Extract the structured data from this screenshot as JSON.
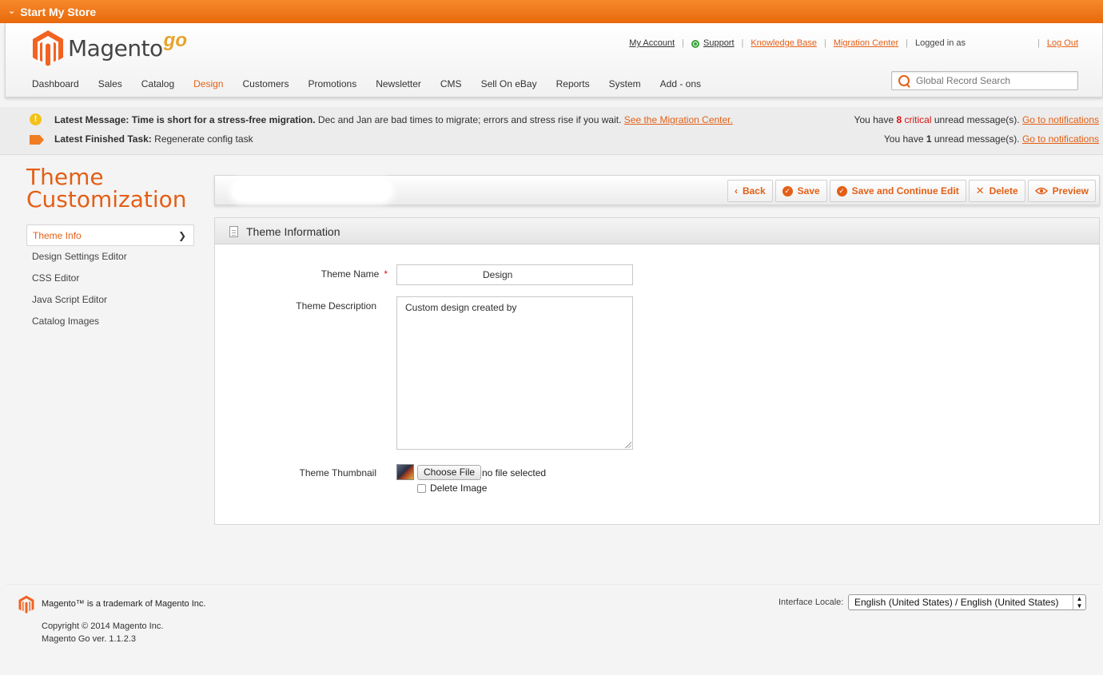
{
  "topbar": {
    "label": "Start My Store"
  },
  "header": {
    "brand": "Magento",
    "brand_suffix": "go",
    "links": {
      "my_account": "My Account",
      "support": "Support",
      "knowledge_base": "Knowledge Base",
      "migration_center": "Migration Center",
      "logged_in": "Logged in as",
      "log_out": "Log Out"
    },
    "nav": [
      "Dashboard",
      "Sales",
      "Catalog",
      "Design",
      "Customers",
      "Promotions",
      "Newsletter",
      "CMS",
      "Sell On eBay",
      "Reports",
      "System",
      "Add - ons"
    ],
    "nav_active": "Design",
    "search": {
      "placeholder": "Global Record Search"
    }
  },
  "messages": {
    "latest_label": "Latest Message:",
    "latest_bold": "Time is short for a stress-free migration.",
    "latest_text": "Dec and Jan are bad times to migrate; errors and stress rise if you wait.",
    "latest_link": "See the Migration Center.",
    "critical_prefix": "You have",
    "critical_count": "8 critical",
    "critical_suffix": "unread message(s).",
    "notif_link": "Go to notifications",
    "task_label": "Latest Finished Task:",
    "task_text": "Regenerate config task",
    "unread_prefix": "You have",
    "unread_count": "1",
    "unread_suffix": "unread message(s).",
    "notif_link2": "Go to notifications"
  },
  "sidebar": {
    "title_line1": "Theme",
    "title_line2": "Customization",
    "tabs": [
      {
        "label": "Theme Info"
      },
      {
        "label": "Design Settings Editor"
      },
      {
        "label": "CSS Editor"
      },
      {
        "label": "Java Script Editor"
      },
      {
        "label": "Catalog Images"
      }
    ]
  },
  "toolbar": {
    "back": "Back",
    "save": "Save",
    "save_continue": "Save and Continue Edit",
    "delete": "Delete",
    "preview": "Preview"
  },
  "form": {
    "section_title": "Theme Information",
    "name_label": "Theme Name",
    "required_mark": "*",
    "name_value": "Design",
    "desc_label": "Theme Description",
    "desc_value": "Custom design created by",
    "thumb_label": "Theme Thumbnail",
    "choose_file": "Choose File",
    "file_status": "no file selected",
    "delete_image": "Delete Image"
  },
  "footer": {
    "trademark": "Magento™ is a trademark of Magento Inc.",
    "copyright": "Copyright © 2014 Magento Inc.",
    "version": "Magento Go ver. 1.1.2.3",
    "locale_label": "Interface Locale:",
    "locale_value": "English (United States) / English (United States)"
  }
}
